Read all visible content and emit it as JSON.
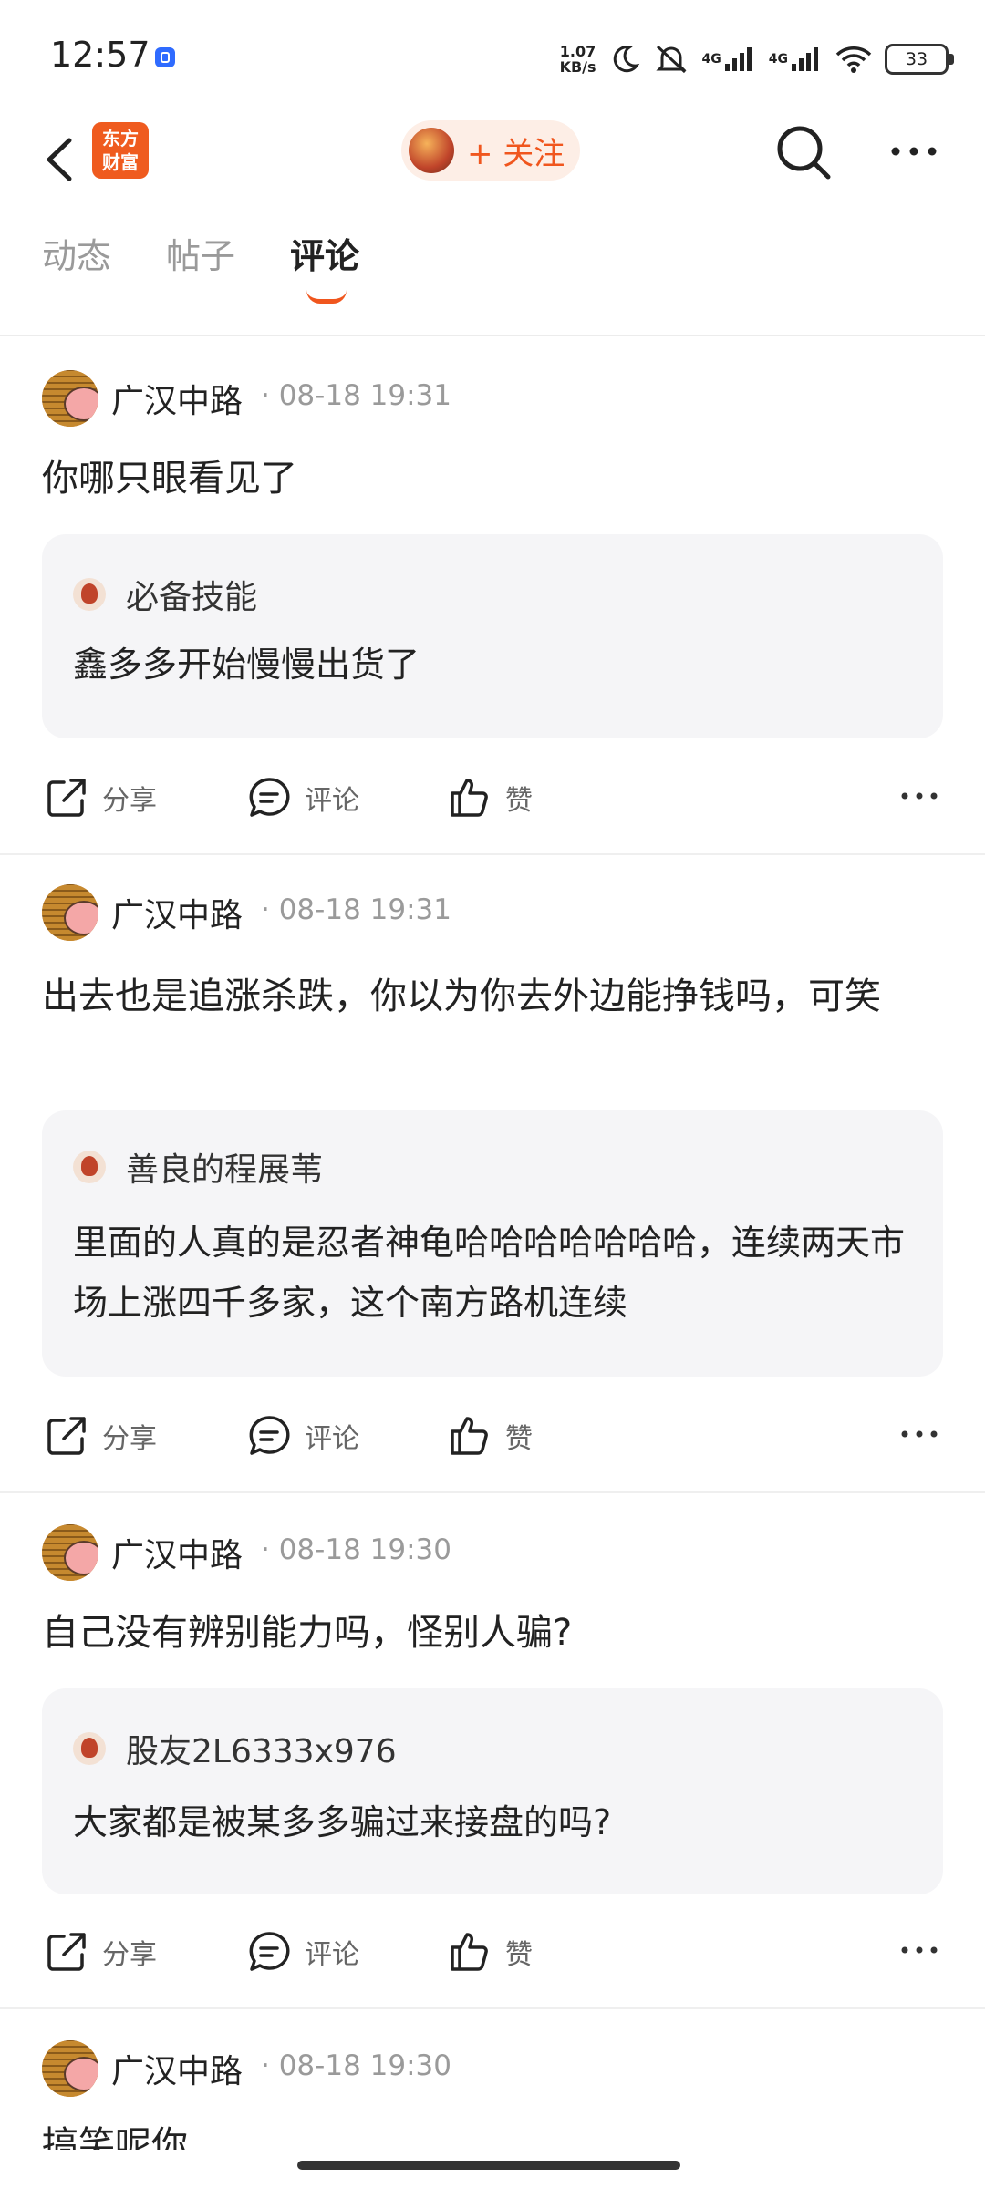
{
  "status_bar": {
    "time": "12:57",
    "net_speed_value": "1.07",
    "net_speed_unit": "KB/s",
    "signal_1": "4G",
    "signal_2": "4G",
    "battery": "33"
  },
  "header": {
    "logo_line1": "东方",
    "logo_line2": "财富",
    "follow_label": "+ 关注"
  },
  "tabs": [
    {
      "label": "动态",
      "active": false
    },
    {
      "label": "帖子",
      "active": false
    },
    {
      "label": "评论",
      "active": true
    }
  ],
  "actions": {
    "share": "分享",
    "comment": "评论",
    "like": "赞"
  },
  "posts": [
    {
      "author": "广汉中路",
      "time": "· 08-18 19:31",
      "text": "你哪只眼看见了",
      "quote_author": "必备技能",
      "quote_text": "鑫多多开始慢慢出货了"
    },
    {
      "author": "广汉中路",
      "time": "· 08-18 19:31",
      "text": "出去也是追涨杀跌，你以为你去外边能挣钱吗，可笑",
      "quote_author": "善良的程展苇",
      "quote_text": "里面的人真的是忍者神龟哈哈哈哈哈哈哈，连续两天市场上涨四千多家，这个南方路机连续"
    },
    {
      "author": "广汉中路",
      "time": "· 08-18 19:30",
      "text": "自己没有辨别能力吗，怪别人骗?",
      "quote_author": "股友2L6333x976",
      "quote_text": "大家都是被某多多骗过来接盘的吗?"
    },
    {
      "author": "广汉中路",
      "time": "· 08-18 19:30",
      "text": "搞笑呢你"
    }
  ]
}
